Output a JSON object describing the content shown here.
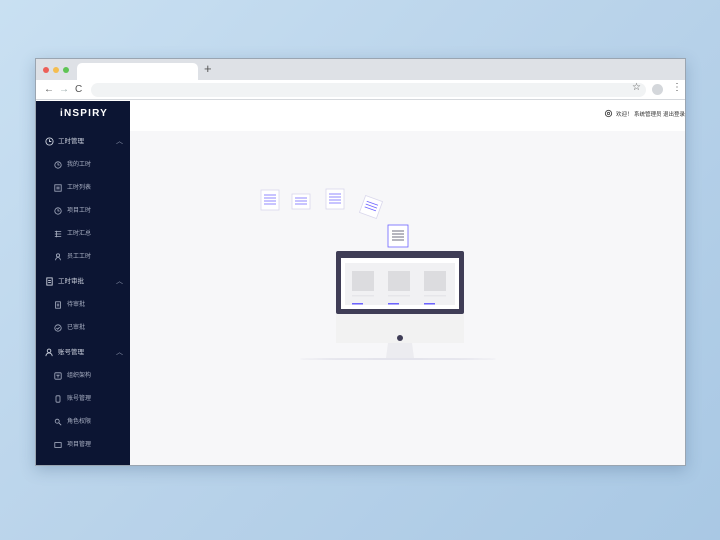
{
  "browser": {
    "new_tab_symbol": "+",
    "nav_back": "←",
    "nav_forward": "→",
    "nav_reload": "C",
    "bookmark_symbol": "☆",
    "menu_symbol": "⋮"
  },
  "sidebar": {
    "logo": "iNSPIRY",
    "groups": [
      {
        "label": "工时管理",
        "icon": "clock-icon",
        "expanded": true,
        "items": [
          {
            "label": "我的工时",
            "icon": "clock-icon"
          },
          {
            "label": "工时列表",
            "icon": "list-icon"
          },
          {
            "label": "项目工时",
            "icon": "clock-icon"
          },
          {
            "label": "工时汇总",
            "icon": "table-icon"
          },
          {
            "label": "员工工时",
            "icon": "person-icon"
          }
        ]
      },
      {
        "label": "工时审批",
        "icon": "document-icon",
        "expanded": true,
        "items": [
          {
            "label": "待审批",
            "icon": "document-icon"
          },
          {
            "label": "已审批",
            "icon": "check-circle-icon"
          }
        ]
      },
      {
        "label": "账号管理",
        "icon": "user-icon",
        "expanded": true,
        "items": [
          {
            "label": "组织架构",
            "icon": "org-icon"
          },
          {
            "label": "账号管理",
            "icon": "phone-icon"
          },
          {
            "label": "角色权限",
            "icon": "key-icon"
          },
          {
            "label": "项目管理",
            "icon": "folder-icon"
          }
        ]
      }
    ]
  },
  "header": {
    "user_text": "欢迎！ 系统管理员  退出登录",
    "settings_icon": "gear-icon"
  },
  "colors": {
    "sidebar_bg": "#0c1533",
    "accent": "#6c63ff",
    "monitor_frame": "#3f3d56"
  }
}
